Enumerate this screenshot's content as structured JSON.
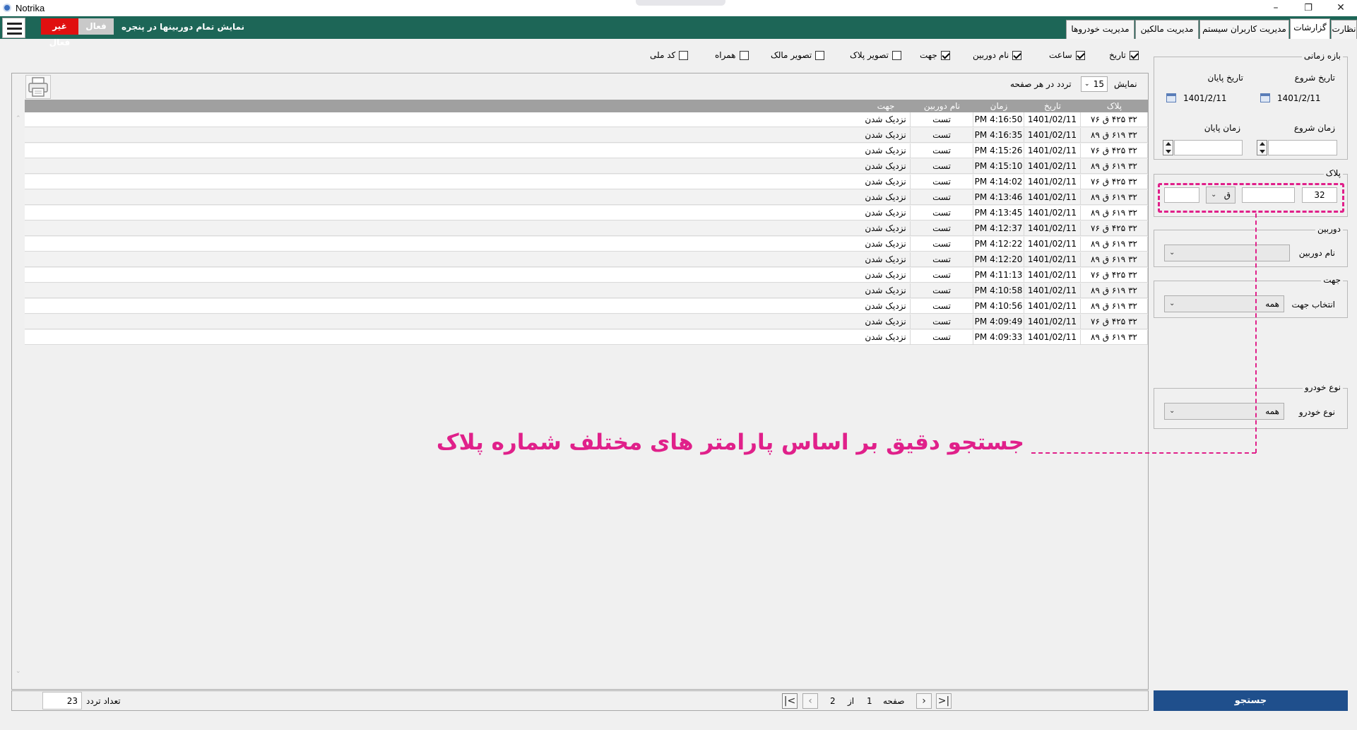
{
  "window": {
    "title": "Notrika",
    "minimize": "–",
    "maximize": "❐",
    "close": "✕"
  },
  "topbar": {
    "show_all_cameras": "نمایش تمام دوربینها در پنجره",
    "toggle_on": "فعال",
    "toggle_off": "غیر فعال",
    "tabs": [
      "نظارت",
      "گزارشات",
      "مدیریت کاربران سیستم",
      "مدیریت مالکین",
      "مدیریت خودروها"
    ]
  },
  "columns": [
    {
      "label": "تاریخ",
      "checked": true
    },
    {
      "label": "ساعت",
      "checked": true
    },
    {
      "label": "نام دوربین",
      "checked": true
    },
    {
      "label": "جهت",
      "checked": true
    },
    {
      "label": "تصویر پلاک",
      "checked": false
    },
    {
      "label": "تصویر مالک",
      "checked": false
    },
    {
      "label": "همراه",
      "checked": false
    },
    {
      "label": "کد ملی",
      "checked": false
    }
  ],
  "filters": {
    "time_range": {
      "legend": "بازه زمانی",
      "start_date_label": "تاریخ شروع",
      "end_date_label": "تاریخ پایان",
      "start_date": "1401/2/11",
      "end_date": "1401/2/11",
      "start_time_label": "زمان شروع",
      "end_time_label": "زمان پایان",
      "start_time": "",
      "end_time": ""
    },
    "plate": {
      "legend": "پلاک",
      "part1": "32",
      "part2": "",
      "letter": "ق",
      "part4": ""
    },
    "camera": {
      "legend": "دوربین",
      "label": "نام دوربین",
      "value": ""
    },
    "direction": {
      "legend": "جهت",
      "label": "انتخاب جهت",
      "value": "همه"
    },
    "vehicle_type": {
      "legend": "نوع خودرو",
      "label": "نوع خودرو",
      "value": "همه"
    },
    "search_button": "جستجو"
  },
  "annotation": "جستجو دقیق بر اساس پارامتر های مختلف شماره پلاک",
  "grid": {
    "show_label": "نمایش",
    "page_size": "15",
    "per_page_label": "تردد در هر صفحه",
    "headers": [
      "پلاک",
      "تاریخ",
      "زمان",
      "نام دوربین",
      "جهت"
    ],
    "rows": [
      [
        "۳۲ ۴۲۵ ق ۷۶",
        "1401/02/11",
        "4:16:50 PM",
        "تست",
        "نزدیک شدن"
      ],
      [
        "۳۲ ۶۱۹ ق ۸۹",
        "1401/02/11",
        "4:16:35 PM",
        "تست",
        "نزدیک شدن"
      ],
      [
        "۳۲ ۴۲۵ ق ۷۶",
        "1401/02/11",
        "4:15:26 PM",
        "تست",
        "نزدیک شدن"
      ],
      [
        "۳۲ ۶۱۹ ق ۸۹",
        "1401/02/11",
        "4:15:10 PM",
        "تست",
        "نزدیک شدن"
      ],
      [
        "۳۲ ۴۲۵ ق ۷۶",
        "1401/02/11",
        "4:14:02 PM",
        "تست",
        "نزدیک شدن"
      ],
      [
        "۳۲ ۶۱۹ ق ۸۹",
        "1401/02/11",
        "4:13:46 PM",
        "تست",
        "نزدیک شدن"
      ],
      [
        "۳۲ ۶۱۹ ق ۸۹",
        "1401/02/11",
        "4:13:45 PM",
        "تست",
        "نزدیک شدن"
      ],
      [
        "۳۲ ۴۲۵ ق ۷۶",
        "1401/02/11",
        "4:12:37 PM",
        "تست",
        "نزدیک شدن"
      ],
      [
        "۳۲ ۶۱۹ ق ۸۹",
        "1401/02/11",
        "4:12:22 PM",
        "تست",
        "نزدیک شدن"
      ],
      [
        "۳۲ ۶۱۹ ق ۸۹",
        "1401/02/11",
        "4:12:20 PM",
        "تست",
        "نزدیک شدن"
      ],
      [
        "۳۲ ۴۲۵ ق ۷۶",
        "1401/02/11",
        "4:11:13 PM",
        "تست",
        "نزدیک شدن"
      ],
      [
        "۳۲ ۶۱۹ ق ۸۹",
        "1401/02/11",
        "4:10:58 PM",
        "تست",
        "نزدیک شدن"
      ],
      [
        "۳۲ ۶۱۹ ق ۸۹",
        "1401/02/11",
        "4:10:56 PM",
        "تست",
        "نزدیک شدن"
      ],
      [
        "۳۲ ۴۲۵ ق ۷۶",
        "1401/02/11",
        "4:09:49 PM",
        "تست",
        "نزدیک شدن"
      ],
      [
        "۳۲ ۶۱۹ ق ۸۹",
        "1401/02/11",
        "4:09:33 PM",
        "تست",
        "نزدیک شدن"
      ]
    ]
  },
  "footer": {
    "count_label": "تعداد تردد",
    "count": "23",
    "page_label": "صفحه",
    "current_page": "1",
    "of_label": "از",
    "total_pages": "2"
  },
  "icons": {
    "hamburger": "menu-icon",
    "printer": "printer-icon",
    "calendar": "calendar-icon",
    "first": "first-page-icon",
    "prev": "prev-page-icon",
    "next": "next-page-icon",
    "last": "last-page-icon"
  },
  "colors": {
    "topbar": "#1d6657",
    "toggle_off": "#e01010",
    "search_button": "#1f4f8c",
    "highlight": "#e0208a"
  }
}
